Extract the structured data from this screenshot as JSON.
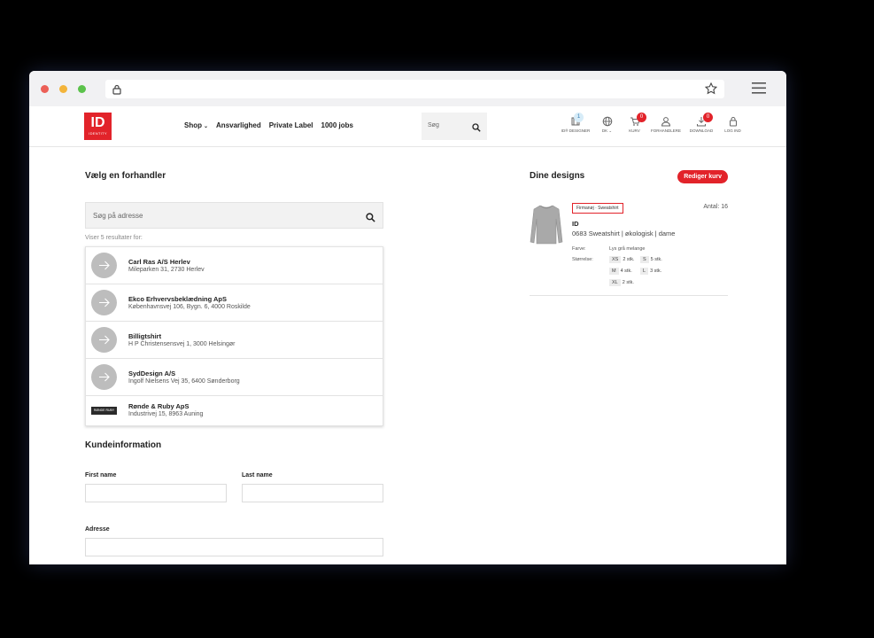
{
  "browser": {
    "url": ""
  },
  "header": {
    "logo_main": "ID",
    "logo_sub": "IDENTITY",
    "nav": [
      {
        "label": "Shop",
        "has_dropdown": true
      },
      {
        "label": "Ansvarlighed"
      },
      {
        "label": "Private Label"
      },
      {
        "label": "1000 jobs"
      }
    ],
    "search_placeholder": "Søg",
    "icons": [
      {
        "label": "ID® DESIGNER",
        "icon": "shirt-designer-icon",
        "badge": "1"
      },
      {
        "label": "DK",
        "icon": "globe-icon",
        "has_dropdown": true
      },
      {
        "label": "KURV",
        "icon": "cart-icon",
        "badge": "0"
      },
      {
        "label": "FORHANDLERE",
        "icon": "person-icon"
      },
      {
        "label": "DOWNLOAD",
        "icon": "download-icon",
        "badge": "0"
      },
      {
        "label": "LOG IND",
        "icon": "lock-icon"
      }
    ]
  },
  "dealer_section": {
    "title": "Vælg en forhandler",
    "search_placeholder": "Søg på adresse",
    "results_text": "Viser 5 resultater for:",
    "dealers": [
      {
        "name": "Carl Ras A/S Herlev",
        "address": "Mileparken 31, 2730 Herlev"
      },
      {
        "name": "Ekco Erhvervsbeklædning ApS",
        "address": "Københavnsvej 106, Bygn. 6, 4000 Roskilde"
      },
      {
        "name": "Billigtshirt",
        "address": "H P Christensensvej 1, 3000 Helsingør"
      },
      {
        "name": "SydDesign A/S",
        "address": "Ingolf Nielsens Vej 35, 6400 Sønderborg"
      },
      {
        "name": "Rønde & Ruby ApS",
        "address": "Industrivej 15, 8963 Auning",
        "logo_text": "RØNDE RUBY"
      }
    ]
  },
  "customer_section": {
    "title": "Kundeinformation",
    "first_name_label": "First name",
    "last_name_label": "Last name",
    "address_label": "Adresse"
  },
  "designs": {
    "title": "Dine designs",
    "edit_button": "Rediger kurv",
    "item": {
      "tag": "Firmanøj · Sweatshirt",
      "quantity": "Antal: 16",
      "brand": "ID",
      "description": "0683 Sweatshirt | økologisk | dame",
      "color_label": "Farve:",
      "color_value": "Lys grå melange",
      "size_label": "Størrelse:",
      "sizes": [
        {
          "size": "XS",
          "qty": "2 stk."
        },
        {
          "size": "S",
          "qty": "5 stk."
        },
        {
          "size": "M",
          "qty": "4 stk."
        },
        {
          "size": "L",
          "qty": "3 stk."
        },
        {
          "size": "XL",
          "qty": "2 stk."
        }
      ]
    }
  },
  "colors": {
    "brand_red": "#e2232a",
    "badge_blue": "#d7ecf8"
  }
}
